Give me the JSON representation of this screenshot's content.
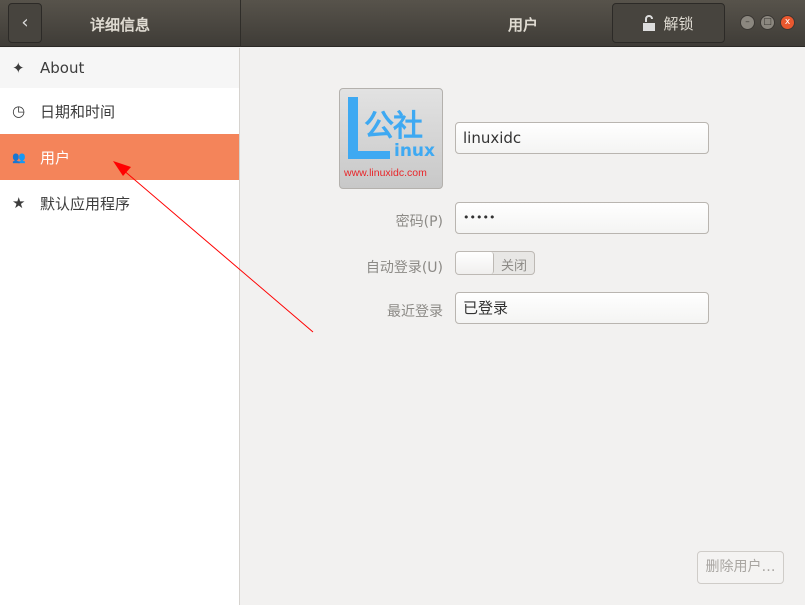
{
  "header": {
    "left_title": "详细信息",
    "title": "用户",
    "unlock_label": "解锁",
    "back_icon": "chevron-left-icon",
    "lock_icon": "unlock-icon"
  },
  "window_controls": {
    "minimize": "–",
    "maximize": "□",
    "close": "x"
  },
  "sidebar": {
    "items": [
      {
        "label": "About",
        "icon": "✦"
      },
      {
        "label": "日期和时间",
        "icon": "◷"
      },
      {
        "label": "用户",
        "icon": "👥",
        "selected": true
      },
      {
        "label": "默认应用程序",
        "icon": "★"
      }
    ]
  },
  "user": {
    "avatar": {
      "logo_text_cn": "公社",
      "logo_text_en": "inux",
      "logo_url": "www.linuxidc.com"
    },
    "name": "linuxidc",
    "password_label": "密码(P)",
    "password_value": "•••••",
    "autologin_label": "自动登录(U)",
    "autologin_state": "关闭",
    "autologin_on": false,
    "last_login_label": "最近登录",
    "last_login_value": "已登录",
    "delete_label": "删除用户…"
  },
  "colors": {
    "accent": "#f4845a",
    "annotation_arrow": "#ff0000"
  }
}
